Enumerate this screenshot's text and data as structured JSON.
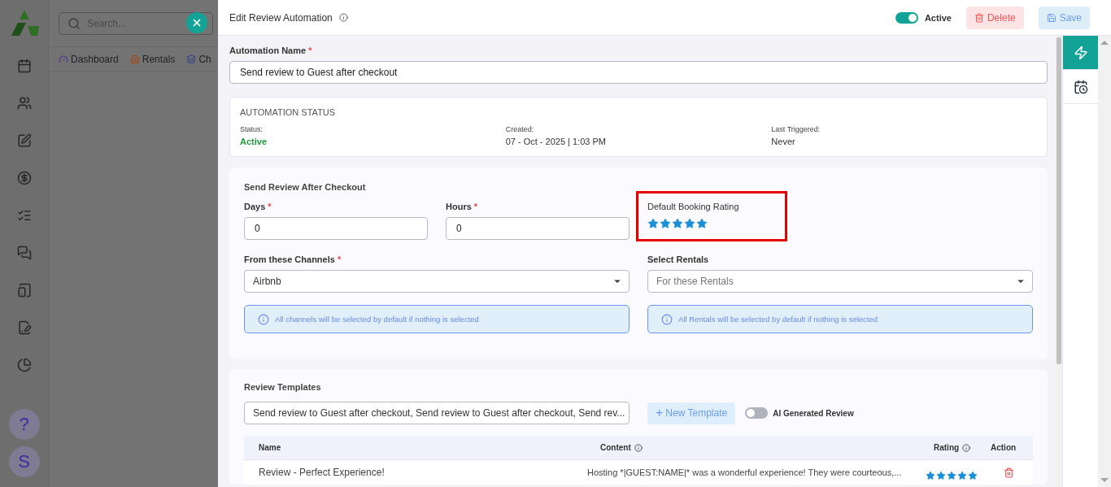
{
  "background_app": {
    "search": {
      "placeholder": "Search..."
    },
    "nav_tabs": [
      {
        "label": "Dashboard"
      },
      {
        "label": "Rentals"
      },
      {
        "label": "Ch"
      }
    ],
    "help": "?",
    "avatar": "S"
  },
  "drawer": {
    "title": "Edit Review Automation",
    "active_toggle": {
      "label": "Active",
      "on": true
    },
    "buttons": [
      {
        "label": "Delete",
        "kind": "danger"
      },
      {
        "label": "Save",
        "kind": "primary"
      }
    ],
    "automation_name": {
      "label": "Automation Name",
      "required_mark": "*",
      "value": "Send review to Guest after checkout"
    },
    "status_card": {
      "title": "AUTOMATION STATUS",
      "items": [
        {
          "label": "Status:",
          "value": "Active",
          "kind": "status"
        },
        {
          "label": "Created:",
          "value": "07 - Oct - 2025 | 1:03 PM",
          "kind": "text"
        },
        {
          "label": "Last Triggered:",
          "value": "Never",
          "kind": "text"
        }
      ]
    },
    "send_review": {
      "title": "Send Review After Checkout",
      "days": {
        "label": "Days",
        "required_mark": "*",
        "value": "0"
      },
      "hours": {
        "label": "Hours",
        "required_mark": "*",
        "value": "0"
      },
      "default_rating": {
        "label": "Default Booking Rating",
        "stars": 5,
        "highlighted": true
      },
      "channels": {
        "label": "From these Channels",
        "required_mark": "*",
        "value": "Airbnb",
        "note": "All channels will be selected by default if nothing is selected"
      },
      "rentals": {
        "label": "Select Rentals",
        "placeholder": "For these Rentals",
        "note": "All Rentals will be selected by default if nothing is selected"
      }
    },
    "review_templates": {
      "title": "Review Templates",
      "select_value": "Send review to Guest after checkout, Send review to Guest after checkout, Send rev...",
      "new_template": {
        "icon": "+",
        "label": "New Template"
      },
      "ai_toggle": {
        "label": "AI Generated Review",
        "on": false
      },
      "columns": [
        {
          "label": "Name",
          "info": false
        },
        {
          "label": "Content",
          "info": true
        },
        {
          "label": "Rating",
          "info": true
        },
        {
          "label": "Action",
          "info": false
        }
      ],
      "rows": [
        {
          "name": "Review - Perfect Experience!",
          "content": "Hosting *|GUEST:NAME|* was a wonderful experience! They were courteous,...",
          "stars": 5
        }
      ]
    },
    "rail": [
      {
        "selected": true
      },
      {
        "selected": false
      }
    ]
  }
}
